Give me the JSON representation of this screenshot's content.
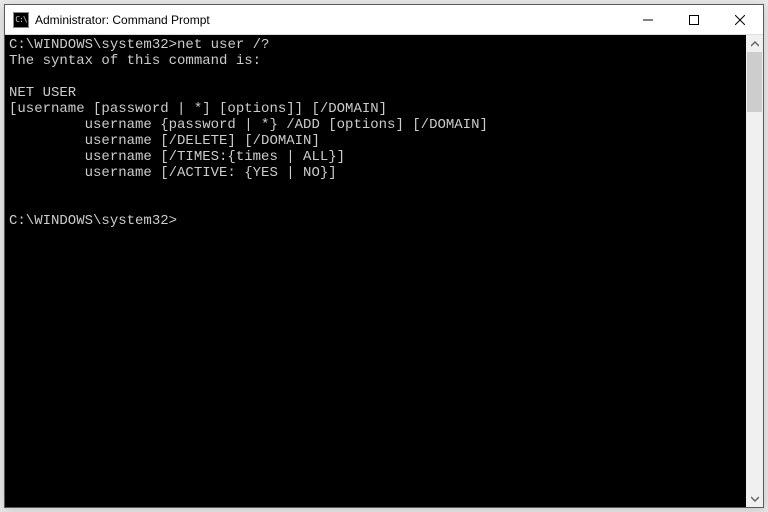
{
  "window": {
    "title": "Administrator: Command Prompt",
    "icon_label": "C:\\"
  },
  "terminal": {
    "line1_prompt": "C:\\WINDOWS\\system32>",
    "line1_cmd": "net user /?",
    "line2": "The syntax of this command is:",
    "line3": "",
    "line4": "NET USER",
    "line5": "[username [password | *] [options]] [/DOMAIN]",
    "line6": "         username {password | *} /ADD [options] [/DOMAIN]",
    "line7": "         username [/DELETE] [/DOMAIN]",
    "line8": "         username [/TIMES:{times | ALL}]",
    "line9": "         username [/ACTIVE: {YES | NO}]",
    "line10": "",
    "line11": "",
    "line12_prompt": "C:\\WINDOWS\\system32>"
  }
}
